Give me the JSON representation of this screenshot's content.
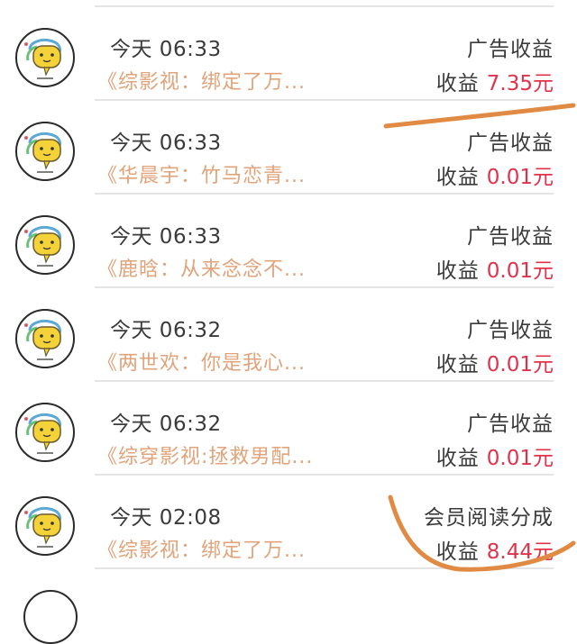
{
  "brand_colors": {
    "title": "#e0a37a",
    "amount": "#e0324a",
    "annotation": "#e08a43"
  },
  "avatar_icon": "chat-bubble-face-icon",
  "rows": [
    {
      "time": "今天 06:33",
      "title": "《综影视：绑定了万...",
      "kind": "广告收益",
      "amount_label": "收益",
      "amount": "7.35元"
    },
    {
      "time": "今天 06:33",
      "title": "《华晨宇：竹马恋青...",
      "kind": "广告收益",
      "amount_label": "收益",
      "amount": "0.01元"
    },
    {
      "time": "今天 06:33",
      "title": "《鹿晗：从来念念不...",
      "kind": "广告收益",
      "amount_label": "收益",
      "amount": "0.01元"
    },
    {
      "time": "今天 06:32",
      "title": "《两世欢：你是我心...",
      "kind": "广告收益",
      "amount_label": "收益",
      "amount": "0.01元"
    },
    {
      "time": "今天 06:32",
      "title": "《综穿影视:拯救男配...",
      "kind": "广告收益",
      "amount_label": "收益",
      "amount": "0.01元"
    },
    {
      "time": "今天 02:08",
      "title": "《综影视：绑定了万...",
      "kind": "会员阅读分成",
      "amount_label": "收益",
      "amount": "8.44元"
    }
  ]
}
